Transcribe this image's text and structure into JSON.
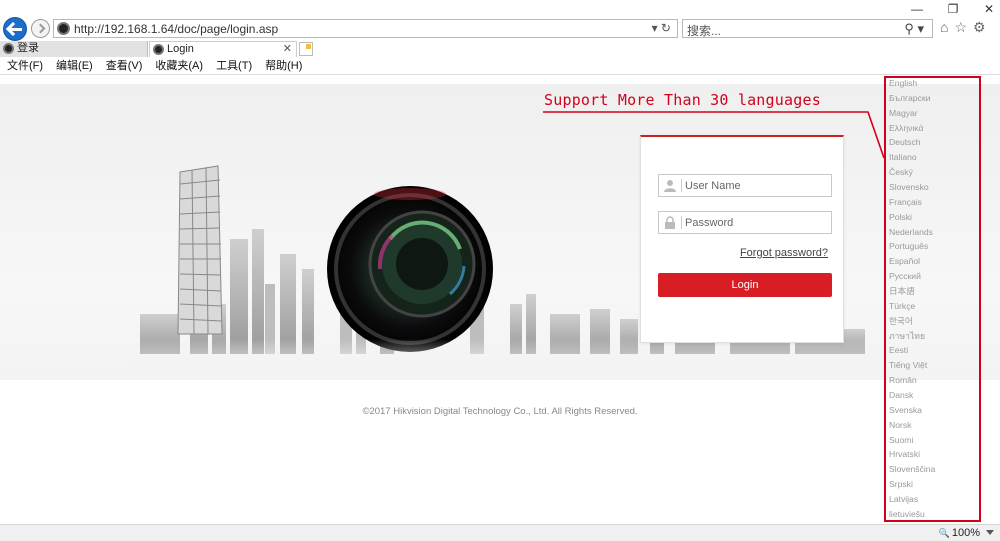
{
  "browser": {
    "window_controls": [
      "—",
      "❐",
      "✕"
    ],
    "url": "http://192.168.1.64/doc/page/login.asp",
    "address_icons": "▾  ↻",
    "search_placeholder": "搜索...",
    "search_icon": "⚲ ▾",
    "tool_icons": [
      "⌂",
      "☆",
      "⚙"
    ],
    "tabs": [
      {
        "label": "登录",
        "active": false
      },
      {
        "label": "Login",
        "active": true,
        "close": "✕"
      }
    ],
    "menu": [
      "文件(F)",
      "编辑(E)",
      "查看(V)",
      "收藏夹(A)",
      "工具(T)",
      "帮助(H)"
    ],
    "zoom": "100%"
  },
  "login": {
    "username_placeholder": "User Name",
    "password_placeholder": "Password",
    "forgot_password": "Forgot password?",
    "login_button": "Login",
    "accent_color": "#d91d24"
  },
  "footer": {
    "copyright": "©2017 Hikvision Digital Technology Co., Ltd. All Rights Reserved."
  },
  "annotation": {
    "text": "Support More Than 30 languages",
    "color": "#d0021b"
  },
  "languages": [
    "English",
    "Български",
    "Magyar",
    "Ελληνικά",
    "Deutsch",
    "Italiano",
    "Český",
    "Slovensko",
    "Français",
    "Polski",
    "Nederlands",
    "Português",
    "Español",
    "Русский",
    "日本語",
    "Türkçe",
    "한국어",
    "ภาษาไทย",
    "Eesti",
    "Tiếng Việt",
    "Român",
    "Dansk",
    "Svenska",
    "Norsk",
    "Suomi",
    "Hrvatski",
    "Slovenščina",
    "Srpski",
    "Latvijas",
    "lietuviešu"
  ]
}
